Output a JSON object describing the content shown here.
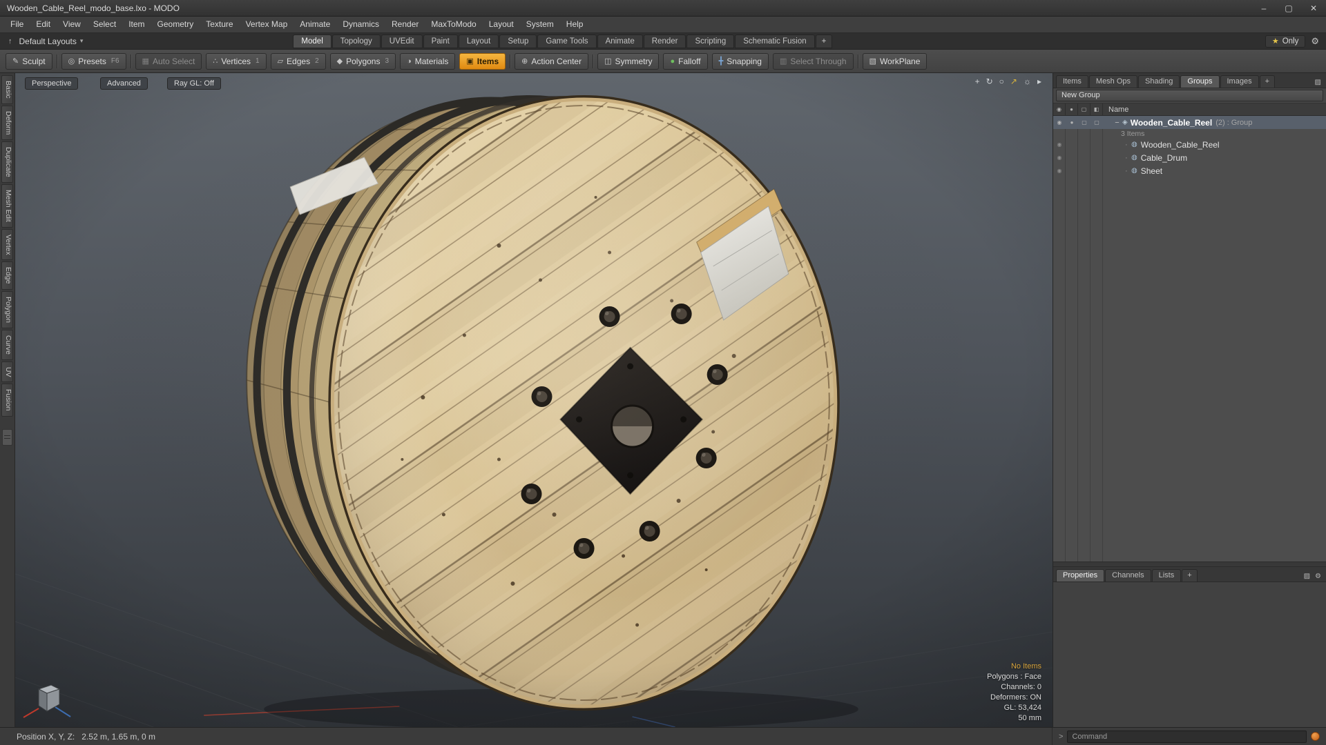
{
  "window": {
    "title": "Wooden_Cable_Reel_modo_base.lxo - MODO"
  },
  "menu": {
    "items": [
      "File",
      "Edit",
      "View",
      "Select",
      "Item",
      "Geometry",
      "Texture",
      "Vertex Map",
      "Animate",
      "Dynamics",
      "Render",
      "MaxToModo",
      "Layout",
      "System",
      "Help"
    ]
  },
  "layout_bar": {
    "preset_label": "Default Layouts",
    "tabs": [
      "Model",
      "Topology",
      "UVEdit",
      "Paint",
      "Layout",
      "Setup",
      "Game Tools",
      "Animate",
      "Render",
      "Scripting",
      "Schematic Fusion"
    ],
    "active_tab": "Model",
    "only_label": "Only"
  },
  "toolbar": {
    "items": [
      {
        "label": "Sculpt"
      },
      {
        "label": "Presets",
        "num": "F6"
      },
      {
        "label": "Auto Select"
      },
      {
        "label": "Vertices",
        "num": "1"
      },
      {
        "label": "Edges",
        "num": "2"
      },
      {
        "label": "Polygons",
        "num": "3"
      },
      {
        "label": "Materials"
      },
      {
        "label": "Items"
      },
      {
        "label": "Action Center"
      },
      {
        "label": "Symmetry"
      },
      {
        "label": "Falloff"
      },
      {
        "label": "Snapping"
      },
      {
        "label": "Select Through"
      },
      {
        "label": "WorkPlane"
      }
    ]
  },
  "left_tabs": [
    "Basic",
    "Deform",
    "Duplicate",
    "Mesh Edit",
    "Vertex",
    "Edge",
    "Polygon",
    "Curve",
    "UV",
    "Fusion"
  ],
  "viewport": {
    "buttons": [
      "Perspective",
      "Advanced",
      "Ray GL: Off"
    ],
    "stats": [
      "No Items",
      "Polygons : Face",
      "Channels: 0",
      "Deformers: ON",
      "GL: 53,424",
      "50 mm"
    ]
  },
  "right_panel": {
    "tabs": [
      "Items",
      "Mesh Ops",
      "Shading",
      "Groups",
      "Images"
    ],
    "active_tab": "Groups",
    "new_group_label": "New Group",
    "name_header": "Name",
    "tree": {
      "root_name": "Wooden_Cable_Reel",
      "root_suffix": "(2) : Group",
      "count_label": "3 Items",
      "children": [
        "Wooden_Cable_Reel",
        "Cable_Drum",
        "Sheet"
      ]
    },
    "prop_tabs": [
      "Properties",
      "Channels",
      "Lists"
    ],
    "active_prop_tab": "Properties",
    "command_placeholder": "Command"
  },
  "status_bar": {
    "position_label": "Position X, Y, Z:",
    "position_value": "2.52 m, 1.65 m, 0 m"
  },
  "colors": {
    "accent_orange": "#e8920e",
    "star_yellow": "#e5c54a",
    "falloff_green": "#6fbf5f",
    "snapping_blue": "#7ba7d7",
    "stats_highlight": "#d8a43c",
    "command_dot": "#cf7a30",
    "selected_row": "#58606b"
  },
  "icons": {
    "minimize": "–",
    "maximize": "▢",
    "close": "✕",
    "layout_up": "↑",
    "dropdown": "▾",
    "plus": "+",
    "star": "★",
    "gear": "⚙",
    "sculpt": "✎",
    "presets": "◎",
    "auto_select": "▦",
    "vertices": "∴",
    "edges": "▱",
    "polygons": "◆",
    "materials": "◑",
    "items": "▣",
    "action_center": "⊕",
    "symmetry": "◫",
    "falloff": "●",
    "snapping": "╋",
    "select_through": "▥",
    "workplane": "▧",
    "pan": "+",
    "rotate": "↻",
    "zoom": "○",
    "fit": "↗",
    "vp_settings": "☼",
    "vp_expand": "▸",
    "eye": "◉",
    "dot": "●",
    "box": "▢",
    "halfbox": "◧",
    "tree_minus": "−",
    "group": "◈",
    "mesh": "◍",
    "bullet": "·",
    "panel_expand": "▨",
    "prompt": ">"
  }
}
